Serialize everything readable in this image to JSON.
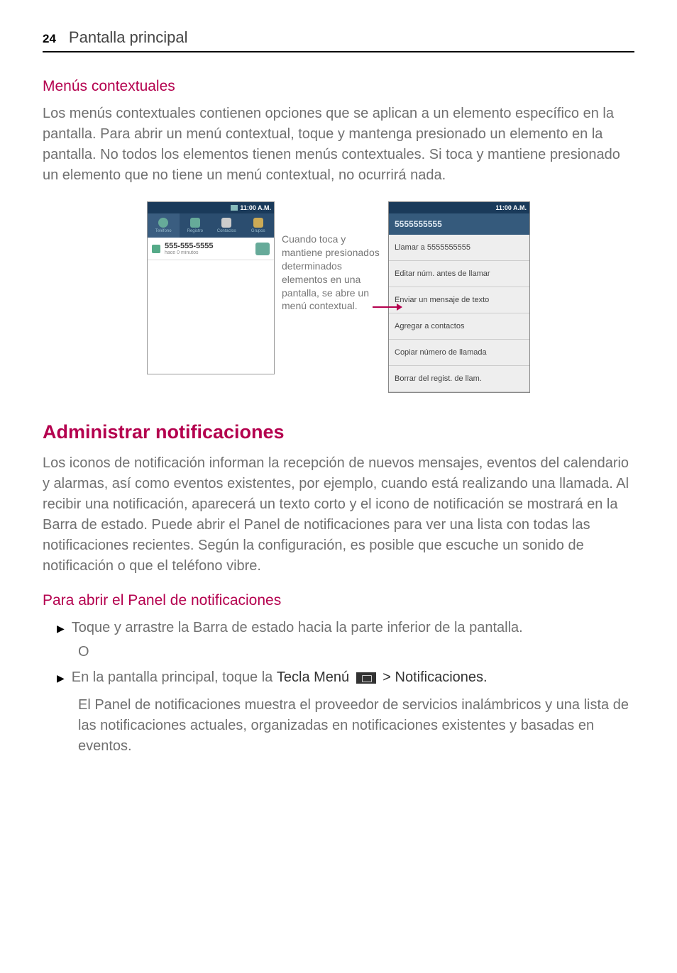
{
  "header": {
    "page_number": "24",
    "section_title": "Pantalla principal"
  },
  "section1": {
    "heading": "Menús contextuales",
    "body": "Los menús contextuales contienen opciones que se aplican a un elemento específico en la pantalla. Para abrir un menú contextual, toque y mantenga presionado un elemento en la pantalla. No todos los elementos tienen menús contextuales. Si toca y mantiene presionado un elemento que no tiene un menú contextual, no ocurrirá nada."
  },
  "figure": {
    "left_status_time": "11:00 A.M.",
    "tabs": {
      "t1": "Teléfono",
      "t2": "Registro",
      "t3": "Contactos",
      "t4": "Grupos"
    },
    "call_number": "555-555-5555",
    "call_sub": "hace 0 minutos",
    "caption": "Cuando toca y mantiene presionados determinados elementos en una pantalla, se abre un menú contextual.",
    "ctx_status_time": "11:00 A.M.",
    "ctx_title": "5555555555",
    "ctx_items": {
      "i1": "Llamar a 5555555555",
      "i2": "Editar núm. antes de llamar",
      "i3": "Enviar un mensaje de texto",
      "i4": "Agregar a contactos",
      "i5": "Copiar número de llamada",
      "i6": "Borrar del regist. de llam."
    }
  },
  "section2": {
    "heading": "Administrar notificaciones",
    "body": "Los iconos de notificación informan la recepción de nuevos mensajes, eventos del calendario y alarmas, así como eventos existentes, por ejemplo, cuando está realizando una llamada. Al recibir una notificación, aparecerá un texto corto y el icono de notificación se mostrará en la Barra de estado. Puede abrir el Panel de notificaciones para ver una lista con todas las notificaciones recientes. Según la configuración, es posible que escuche un sonido de notificación o que el teléfono vibre."
  },
  "section3": {
    "heading": "Para abrir el Panel de notificaciones",
    "bullet1": "Toque y arrastre la Barra de estado hacia la parte inferior de la pantalla.",
    "or": "O",
    "bullet2_a": "En la pantalla principal, toque la ",
    "bullet2_b": "Tecla Menú",
    "bullet2_c": " > ",
    "bullet2_d": "Notificaciones.",
    "after": "El Panel de notificaciones muestra el proveedor de servicios inalámbricos y una lista de las notificaciones actuales, organizadas en notificaciones existentes y basadas en eventos."
  }
}
